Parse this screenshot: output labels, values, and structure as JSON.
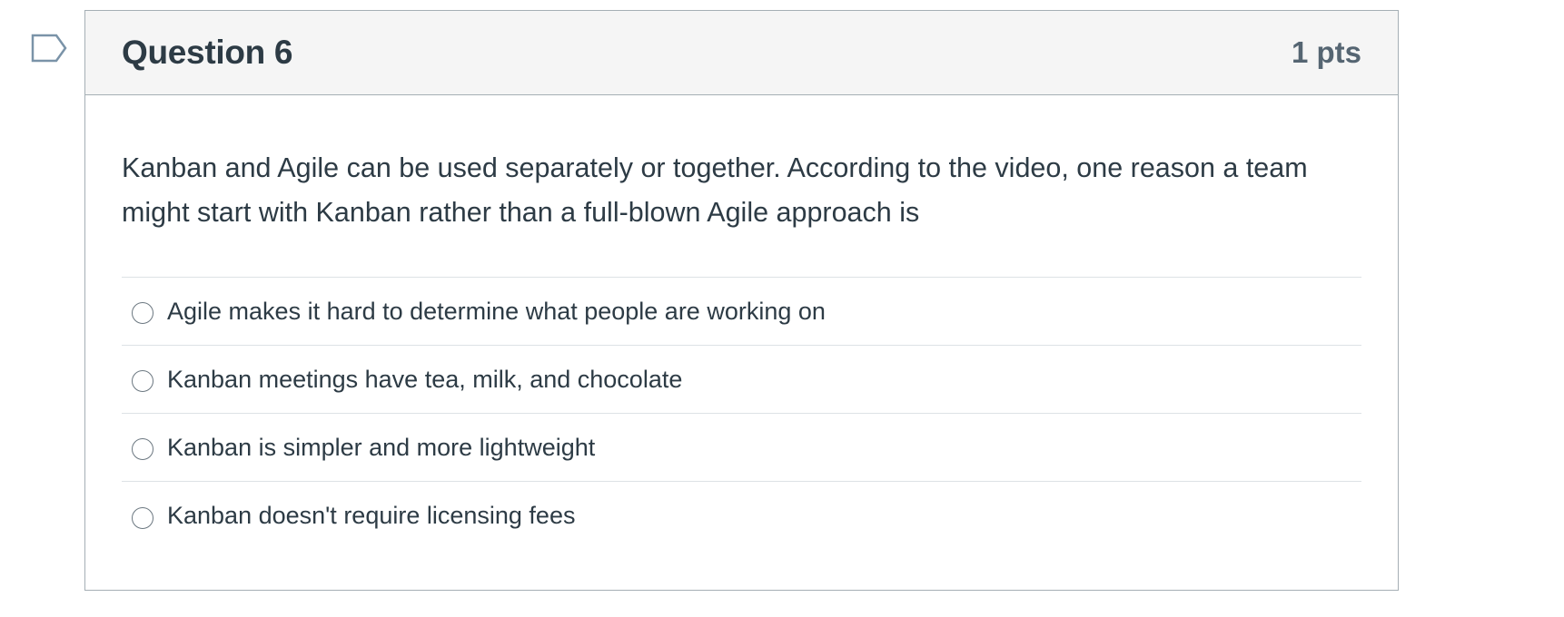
{
  "question": {
    "title": "Question 6",
    "points": "1 pts",
    "text": "Kanban and Agile can be used separately or together. According to the video, one reason a team might start with Kanban rather than a full-blown Agile approach is",
    "answers": [
      {
        "label": "Agile makes it hard to determine what people are working on",
        "selected": false
      },
      {
        "label": "Kanban meetings have tea, milk, and chocolate",
        "selected": false
      },
      {
        "label": "Kanban is simpler and more lightweight",
        "selected": false
      },
      {
        "label": "Kanban doesn't require licensing fees",
        "selected": false
      }
    ]
  },
  "icons": {
    "flag": "flag-question-icon"
  },
  "colors": {
    "header_bg": "#f5f5f5",
    "border": "#a5afb5",
    "text": "#2d3b45",
    "points_text": "#556572",
    "flag_outline": "#7a93a8"
  }
}
